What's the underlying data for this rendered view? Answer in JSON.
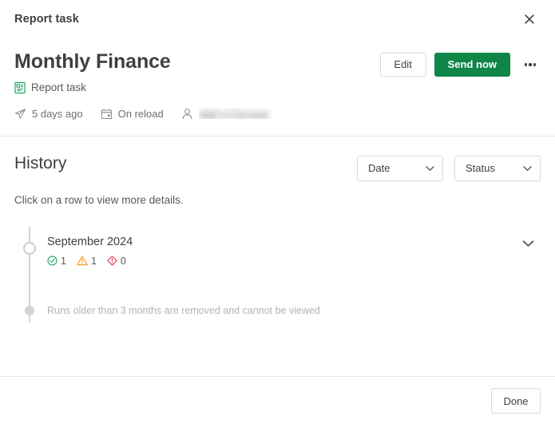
{
  "window": {
    "title": "Report task",
    "close_icon": "close-icon"
  },
  "header": {
    "page_title": "Monthly Finance",
    "subtitle": "Report task",
    "subtitle_icon": "report-task-icon",
    "actions": {
      "edit_label": "Edit",
      "send_now_label": "Send now",
      "more_icon": "ellipsis-icon"
    },
    "meta": [
      {
        "icon": "paper-plane-icon",
        "text": "5 days ago"
      },
      {
        "icon": "calendar-icon",
        "text": "On reload"
      },
      {
        "icon": "user-icon",
        "text": ""
      }
    ]
  },
  "history": {
    "title": "History",
    "hint": "Click on a row to view more details.",
    "filters": [
      {
        "label": "Date",
        "icon": "chevron-down-icon"
      },
      {
        "label": "Status",
        "icon": "chevron-down-icon"
      }
    ],
    "rows": [
      {
        "date": "September 2024",
        "expand_icon": "chevron-down-icon",
        "badges": [
          {
            "icon": "check-circle-icon",
            "count": "1",
            "color": "#21a366"
          },
          {
            "icon": "warning-triangle-icon",
            "count": "1",
            "color": "#f59c2b"
          },
          {
            "icon": "error-diamond-icon",
            "count": "0",
            "color": "#e03757"
          }
        ]
      }
    ],
    "note": "Runs older than 3 months are removed and cannot be viewed"
  },
  "footer": {
    "done_label": "Done"
  },
  "colors": {
    "primary": "#108548",
    "text": "#404040",
    "muted": "#6e6e6e",
    "border": "#d9d9d9",
    "divider": "#e6e6e6",
    "timeline": "#d4d4d4",
    "note_text": "#b3b3b3"
  }
}
